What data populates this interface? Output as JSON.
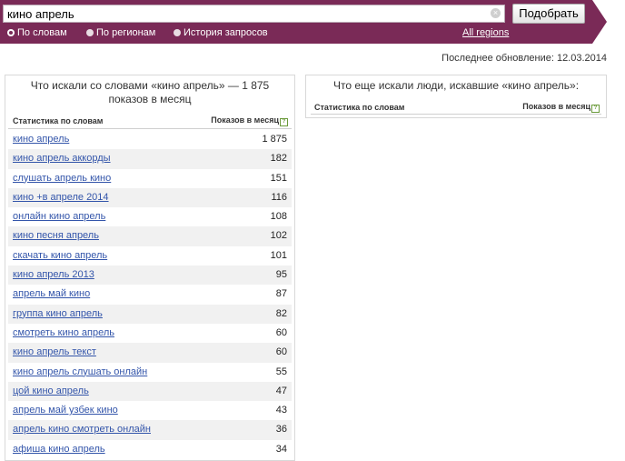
{
  "search": {
    "value": "кино апрель",
    "clear_icon": "clear-icon",
    "submit_label": "Подобрать"
  },
  "modes": [
    {
      "label": "По словам",
      "selected": true
    },
    {
      "label": "По регионам",
      "selected": false
    },
    {
      "label": "История запросов",
      "selected": false
    }
  ],
  "all_regions": "All regions",
  "last_update": "Последнее обновление: 12.03.2014",
  "colors": {
    "header": "#7a2a57",
    "link": "#3355aa",
    "row_alt": "#f1f1f1"
  },
  "left_panel": {
    "title": "Что искали со словами «кино апрель» — 1 875 показов в месяц",
    "col_words": "Статистика по словам",
    "col_shows": "Показов в месяц",
    "help_icon": "?",
    "rows": [
      {
        "phrase": "кино апрель",
        "count": "1 875"
      },
      {
        "phrase": "кино апрель аккорды",
        "count": "182"
      },
      {
        "phrase": "слушать апрель кино",
        "count": "151"
      },
      {
        "phrase": "кино +в апреле 2014",
        "count": "116"
      },
      {
        "phrase": "онлайн кино апрель",
        "count": "108"
      },
      {
        "phrase": "кино песня апрель",
        "count": "102"
      },
      {
        "phrase": "скачать кино апрель",
        "count": "101"
      },
      {
        "phrase": "кино апрель 2013",
        "count": "95"
      },
      {
        "phrase": "апрель май кино",
        "count": "87"
      },
      {
        "phrase": "группа кино апрель",
        "count": "82"
      },
      {
        "phrase": "смотреть кино апрель",
        "count": "60"
      },
      {
        "phrase": "кино апрель текст",
        "count": "60"
      },
      {
        "phrase": "кино апрель слушать онлайн",
        "count": "55"
      },
      {
        "phrase": "цой кино апрель",
        "count": "47"
      },
      {
        "phrase": "апрель май узбек кино",
        "count": "43"
      },
      {
        "phrase": "апрель кино смотреть онлайн",
        "count": "36"
      },
      {
        "phrase": "афиша кино апрель",
        "count": "34"
      }
    ]
  },
  "right_panel": {
    "title": "Что еще искали люди, искавшие «кино апрель»:",
    "col_words": "Статистика по словам",
    "col_shows": "Показов в месяц",
    "help_icon": "?"
  }
}
